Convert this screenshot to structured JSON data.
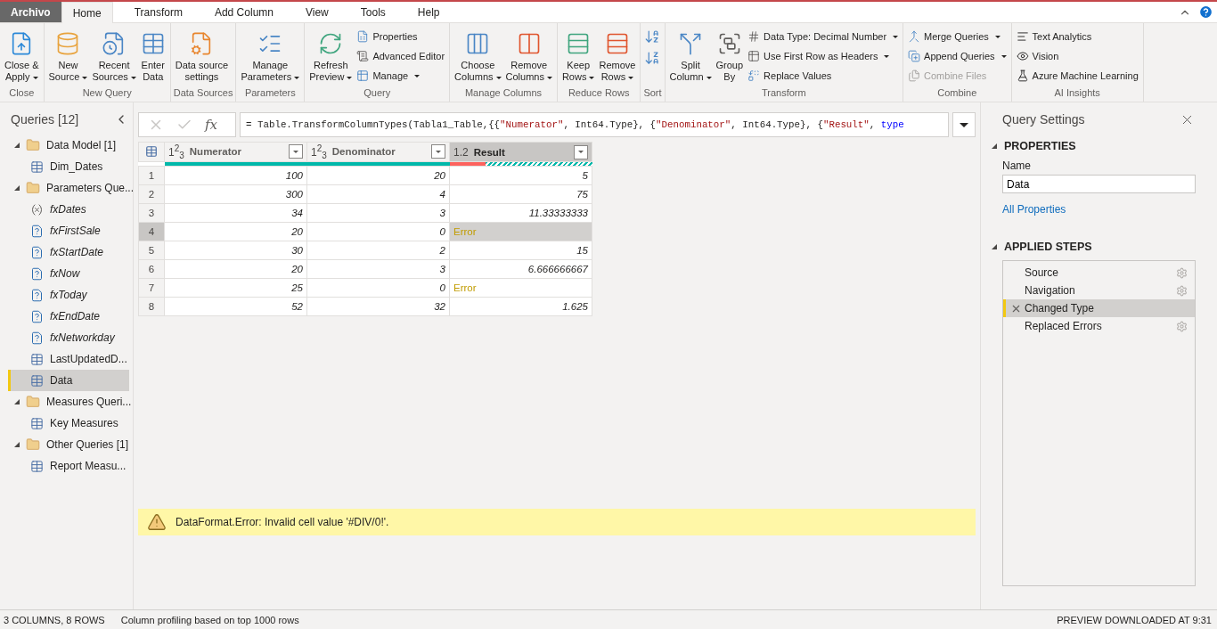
{
  "menu_tabs": [
    {
      "label": "Archivo",
      "kind": "file",
      "selected": false
    },
    {
      "label": "Home",
      "kind": "tab",
      "selected": true
    },
    {
      "label": "Transform",
      "kind": "tab",
      "selected": false
    },
    {
      "label": "Add Column",
      "kind": "tab",
      "selected": false
    },
    {
      "label": "View",
      "kind": "tab",
      "selected": false
    },
    {
      "label": "Tools",
      "kind": "tab",
      "selected": false
    },
    {
      "label": "Help",
      "kind": "tab",
      "selected": false
    }
  ],
  "ribbon": [
    {
      "name": "Close",
      "items": [
        {
          "kind": "large",
          "lines": [
            "Close &",
            "Apply"
          ],
          "dropdown": true
        }
      ]
    },
    {
      "name": "New Query",
      "items": [
        {
          "kind": "large",
          "lines": [
            "New",
            "Source"
          ],
          "dropdown": true
        },
        {
          "kind": "large",
          "lines": [
            "Recent",
            "Sources"
          ],
          "dropdown": true
        },
        {
          "kind": "large",
          "lines": [
            "Enter",
            "Data"
          ],
          "dropdown": false
        }
      ]
    },
    {
      "name": "Data Sources",
      "items": [
        {
          "kind": "large",
          "lines": [
            "Data source",
            "settings"
          ],
          "dropdown": false
        }
      ]
    },
    {
      "name": "Parameters",
      "items": [
        {
          "kind": "large",
          "lines": [
            "Manage",
            "Parameters"
          ],
          "dropdown": true
        }
      ]
    },
    {
      "name": "Query",
      "items": [
        {
          "kind": "large",
          "lines": [
            "Refresh",
            "Preview"
          ],
          "dropdown": true
        },
        {
          "kind": "stack",
          "entries": [
            {
              "label": "Properties",
              "dropdown": false,
              "disabled": false
            },
            {
              "label": "Advanced Editor",
              "dropdown": false,
              "disabled": false
            },
            {
              "label": "Manage",
              "dropdown": true,
              "disabled": false
            }
          ]
        }
      ]
    },
    {
      "name": "Manage Columns",
      "items": [
        {
          "kind": "large",
          "lines": [
            "Choose",
            "Columns"
          ],
          "dropdown": true
        },
        {
          "kind": "large",
          "lines": [
            "Remove",
            "Columns"
          ],
          "dropdown": true
        }
      ]
    },
    {
      "name": "Reduce Rows",
      "items": [
        {
          "kind": "large",
          "lines": [
            "Keep",
            "Rows"
          ],
          "dropdown": true
        },
        {
          "kind": "large",
          "lines": [
            "Remove",
            "Rows"
          ],
          "dropdown": true
        }
      ]
    },
    {
      "name": "Sort",
      "items": [
        {
          "kind": "icons"
        }
      ]
    },
    {
      "name": "Transform",
      "items": [
        {
          "kind": "large",
          "lines": [
            "Split",
            "Column"
          ],
          "dropdown": true
        },
        {
          "kind": "large",
          "lines": [
            "Group",
            "By"
          ],
          "dropdown": false
        },
        {
          "kind": "stack",
          "entries": [
            {
              "label": "Data Type: Decimal Number",
              "dropdown": true,
              "disabled": false
            },
            {
              "label": "Use First Row as Headers",
              "dropdown": true,
              "disabled": false
            },
            {
              "label": "Replace Values",
              "dropdown": false,
              "disabled": false
            }
          ]
        }
      ]
    },
    {
      "name": "Combine",
      "items": [
        {
          "kind": "stack",
          "entries": [
            {
              "label": "Merge Queries",
              "dropdown": true,
              "disabled": false
            },
            {
              "label": "Append Queries",
              "dropdown": true,
              "disabled": false
            },
            {
              "label": "Combine Files",
              "dropdown": false,
              "disabled": true
            }
          ]
        }
      ]
    },
    {
      "name": "AI Insights",
      "items": [
        {
          "kind": "stack",
          "entries": [
            {
              "label": "Text Analytics",
              "dropdown": false,
              "disabled": false
            },
            {
              "label": "Vision",
              "dropdown": false,
              "disabled": false
            },
            {
              "label": "Azure Machine Learning",
              "dropdown": false,
              "disabled": false
            }
          ]
        }
      ]
    }
  ],
  "queries": {
    "title": "Queries [12]",
    "items": [
      {
        "label": "Data Model [1]",
        "kind": "folder",
        "expanded": true,
        "children": [
          {
            "label": "Dim_Dates",
            "kind": "table",
            "selected": false
          }
        ]
      },
      {
        "label": "Parameters Que...",
        "kind": "folder",
        "expanded": true,
        "children": [
          {
            "label": "fxDates",
            "kind": "function",
            "selected": false
          },
          {
            "label": "fxFirstSale",
            "kind": "parameter",
            "selected": false
          },
          {
            "label": "fxStartDate",
            "kind": "parameter",
            "selected": false
          },
          {
            "label": "fxNow",
            "kind": "parameter",
            "selected": false
          },
          {
            "label": "fxToday",
            "kind": "parameter",
            "selected": false
          },
          {
            "label": "fxEndDate",
            "kind": "parameter",
            "selected": false
          },
          {
            "label": "fxNetworkday",
            "kind": "parameter",
            "selected": false
          },
          {
            "label": "LastUpdatedD...",
            "kind": "table",
            "selected": false
          },
          {
            "label": "Data",
            "kind": "table",
            "selected": true
          }
        ]
      },
      {
        "label": "Measures Queri...",
        "kind": "folder",
        "expanded": true,
        "children": [
          {
            "label": "Key Measures",
            "kind": "table",
            "selected": false
          }
        ]
      },
      {
        "label": "Other Queries [1]",
        "kind": "folder",
        "expanded": true,
        "children": [
          {
            "label": "Report Measu...",
            "kind": "table",
            "selected": false
          }
        ]
      }
    ]
  },
  "formula_bar": {
    "fx_label": "fx",
    "segments": [
      {
        "text": "= Table.TransformColumnTypes(Tabla1_Table,{{",
        "kind": "code"
      },
      {
        "text": "\"Numerator\"",
        "kind": "string"
      },
      {
        "text": ", Int64.Type}, {",
        "kind": "code"
      },
      {
        "text": "\"Denominator\"",
        "kind": "string"
      },
      {
        "text": ", Int64.Type}, {",
        "kind": "code"
      },
      {
        "text": "\"Result\"",
        "kind": "string"
      },
      {
        "text": ", ",
        "kind": "code"
      },
      {
        "text": "type",
        "kind": "keyword"
      }
    ]
  },
  "table": {
    "columns": [
      {
        "type_label": "1$^{2}$$_{3}$",
        "name": "Numerator",
        "selected": false,
        "quality": {
          "level": 0,
          "hatched": false
        }
      },
      {
        "type_label": "1$^{2}$$_{3}$",
        "name": "Denominator",
        "selected": false,
        "quality": {
          "level": 0,
          "hatched": false
        }
      },
      {
        "type_label": "1.2",
        "name": "Result",
        "selected": true,
        "quality": {
          "level": 0.25,
          "hatched": true
        }
      }
    ],
    "rows": [
      {
        "number": "1",
        "selected": false,
        "cells": [
          {
            "value": "100",
            "kind": "number"
          },
          {
            "value": "20",
            "kind": "number"
          },
          {
            "value": "5",
            "kind": "number"
          }
        ]
      },
      {
        "number": "2",
        "selected": false,
        "cells": [
          {
            "value": "300",
            "kind": "number"
          },
          {
            "value": "4",
            "kind": "number"
          },
          {
            "value": "75",
            "kind": "number"
          }
        ]
      },
      {
        "number": "3",
        "selected": false,
        "cells": [
          {
            "value": "34",
            "kind": "number"
          },
          {
            "value": "3",
            "kind": "number"
          },
          {
            "value": "11.33333333",
            "kind": "number"
          }
        ]
      },
      {
        "number": "4",
        "selected": true,
        "cells": [
          {
            "value": "20",
            "kind": "number"
          },
          {
            "value": "0",
            "kind": "number"
          },
          {
            "value": "Error",
            "kind": "error"
          }
        ]
      },
      {
        "number": "5",
        "selected": false,
        "cells": [
          {
            "value": "30",
            "kind": "number"
          },
          {
            "value": "2",
            "kind": "number"
          },
          {
            "value": "15",
            "kind": "number"
          }
        ]
      },
      {
        "number": "6",
        "selected": false,
        "cells": [
          {
            "value": "20",
            "kind": "number"
          },
          {
            "value": "3",
            "kind": "number"
          },
          {
            "value": "6.666666667",
            "kind": "number"
          }
        ]
      },
      {
        "number": "7",
        "selected": false,
        "cells": [
          {
            "value": "25",
            "kind": "number"
          },
          {
            "value": "0",
            "kind": "number"
          },
          {
            "value": "Error",
            "kind": "error"
          }
        ]
      },
      {
        "number": "8",
        "selected": false,
        "cells": [
          {
            "value": "52",
            "kind": "number"
          },
          {
            "value": "32",
            "kind": "number"
          },
          {
            "value": "1.625",
            "kind": "number"
          }
        ]
      }
    ]
  },
  "error_message": "DataFormat.Error: Invalid cell value '#DIV/0!'.",
  "query_settings": {
    "title": "Query Settings",
    "properties": {
      "heading": "PROPERTIES",
      "expanded": true,
      "name_label": "Name",
      "name_value": "Data",
      "link": "All Properties"
    },
    "applied_steps": {
      "heading": "APPLIED STEPS",
      "expanded": true,
      "steps": [
        {
          "label": "Source",
          "selected": false,
          "has_settings": true
        },
        {
          "label": "Navigation",
          "selected": false,
          "has_settings": true
        },
        {
          "label": "Changed Type",
          "selected": true,
          "has_settings": false
        },
        {
          "label": "Replaced Errors",
          "selected": false,
          "has_settings": true
        }
      ]
    }
  },
  "status_bar": {
    "left": [
      "3 COLUMNS, 8 ROWS",
      "Column profiling based on top 1000 rows"
    ],
    "right": "PREVIEW DOWNLOADED AT 9:31"
  }
}
